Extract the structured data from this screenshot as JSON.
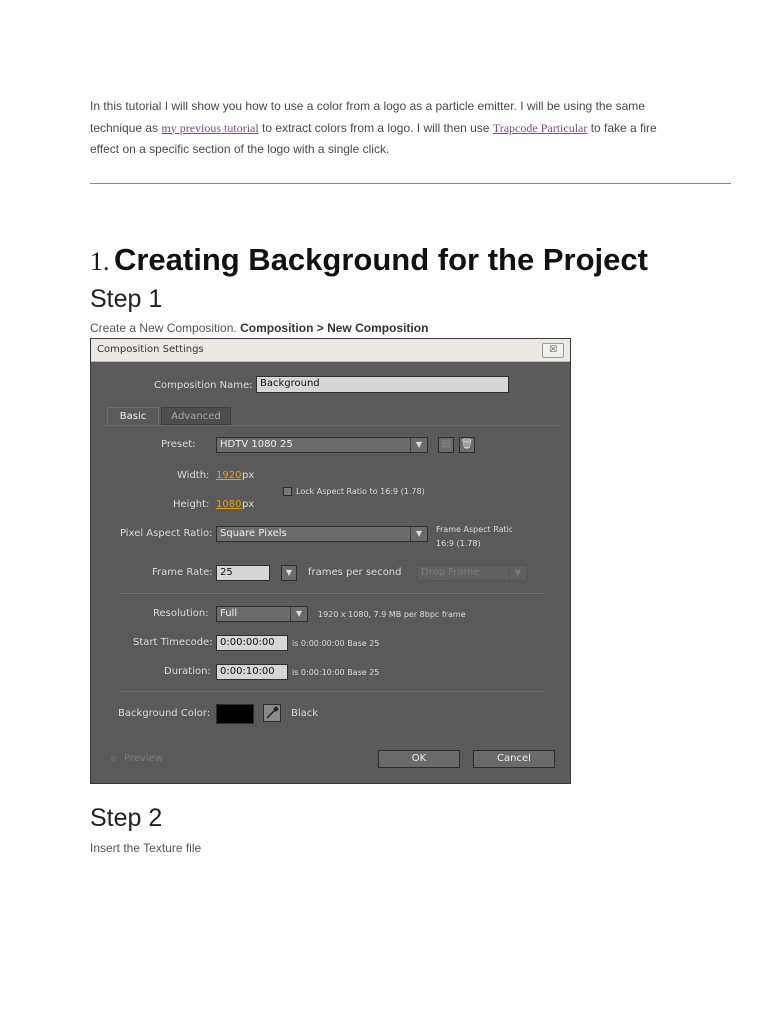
{
  "intro": {
    "part1": "In this tutorial I will show you how to use a color from a logo as a particle emitter. I will be using the same technique as ",
    "link1": "my previous tutorial",
    "part2": " to extract colors from a logo. I will then use ",
    "link2": "Trapcode Particular",
    "part3": " to fake a fire effect on a specific section of the logo with a single click."
  },
  "section": {
    "number": "1.",
    "title": "Creating Background for the Project"
  },
  "step1": {
    "title": "Step 1",
    "desc_prefix": "Create a New Composition. ",
    "desc_bold": "Composition > New Composition"
  },
  "dialog": {
    "title": "Composition Settings",
    "close_label": "☒",
    "comp_name_label": "Composition Name:",
    "comp_name_value": "Background",
    "tabs": [
      "Basic",
      "Advanced"
    ],
    "preset_label": "Preset:",
    "preset_value": "HDTV 1080 25",
    "width_label": "Width:",
    "width_value": "1920",
    "height_label": "Height:",
    "height_value": "1080",
    "px_unit": "px",
    "lock_aspect_label": "Lock Aspect Ratio to 16:9 (1.78)",
    "pixel_aspect_label": "Pixel Aspect Ratio:",
    "pixel_aspect_value": "Square Pixels",
    "frame_aspect_label": "Frame Aspect Ratio:",
    "frame_aspect_value": "16:9 (1.78)",
    "frame_rate_label": "Frame Rate:",
    "frame_rate_value": "25",
    "fps_label": "frames per second",
    "drop_frame_value": "Drop Frame",
    "resolution_label": "Resolution:",
    "resolution_value": "Full",
    "resolution_info": "1920 x 1080, 7.9 MB per 8bpc frame",
    "start_tc_label": "Start Timecode:",
    "start_tc_value": "0:00:00:00",
    "start_tc_info": "is 0:00:00:00  Base 25",
    "duration_label": "Duration:",
    "duration_value": "0:00:10:00",
    "duration_info": "is 0:00:10:00  Base 25",
    "bg_color_label": "Background Color:",
    "bg_color_name": "Black",
    "bg_color_hex": "#000000",
    "preview_label": "Preview",
    "ok_label": "OK",
    "cancel_label": "Cancel"
  },
  "step2": {
    "title": "Step 2",
    "desc": "Insert the Texture file"
  }
}
